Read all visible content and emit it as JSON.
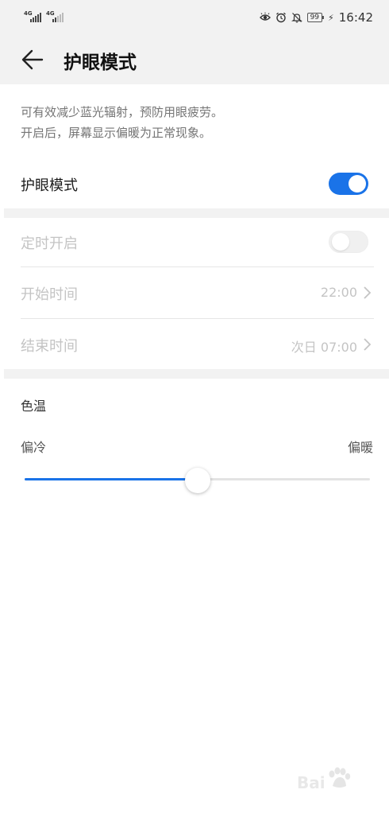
{
  "status_bar": {
    "sim1_network": "4G",
    "sim2_network": "4G",
    "battery": "99",
    "time": "16:42",
    "icons": [
      "eye-icon",
      "alarm-icon",
      "bell-off-icon",
      "battery-icon",
      "charging-bolt-icon"
    ]
  },
  "header": {
    "title": "护眼模式",
    "back_icon": "arrow-left-icon"
  },
  "description": {
    "line1": "可有效减少蓝光辐射，预防用眼疲劳。",
    "line2": "开启后，屏幕显示偏暖为正常现象。"
  },
  "eye_comfort": {
    "label": "护眼模式",
    "enabled": true
  },
  "schedule": {
    "label": "定时开启",
    "enabled": false,
    "start_label": "开始时间",
    "start_value": "22:00",
    "end_label": "结束时间",
    "end_value": "次日 07:00"
  },
  "color_temperature": {
    "section_label": "色温",
    "min_label": "偏冷",
    "max_label": "偏暖",
    "value_percent": 50
  },
  "watermark": {
    "text": "Bai",
    "logo": "baidu-paw-logo"
  },
  "colors": {
    "accent": "#1a73e8",
    "background": "#ffffff",
    "section_gap": "#f2f2f2",
    "disabled_text": "#c4c4c4"
  }
}
